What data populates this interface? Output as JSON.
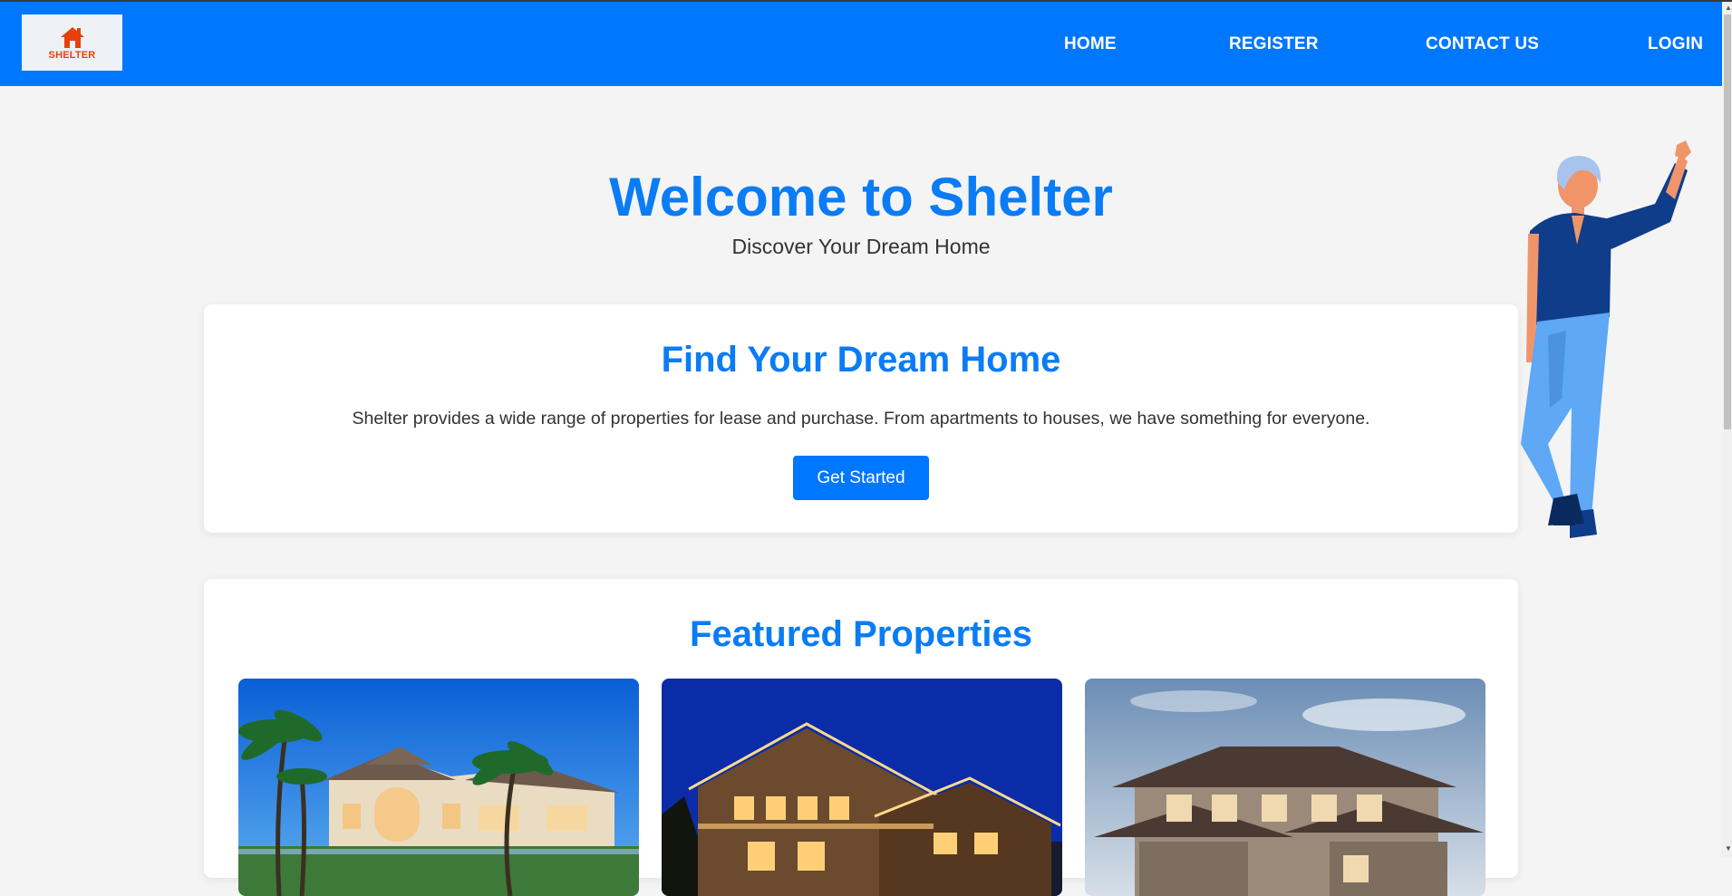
{
  "logo": {
    "text": "SHELTER",
    "icon": "house-icon",
    "color": "#e8400c"
  },
  "nav": {
    "items": [
      {
        "label": "HOME"
      },
      {
        "label": "REGISTER"
      },
      {
        "label": "CONTACT US"
      },
      {
        "label": "LOGIN"
      }
    ],
    "background": "#0077ff"
  },
  "hero": {
    "title": "Welcome to Shelter",
    "subtitle": "Discover Your Dream Home"
  },
  "find": {
    "title": "Find Your Dream Home",
    "text": "Shelter provides a wide range of properties for lease and purchase. From apartments to houses, we have something for everyone.",
    "button": "Get Started"
  },
  "featured": {
    "title": "Featured Properties",
    "properties": [
      {
        "image": "mediterranean-villa-with-palms"
      },
      {
        "image": "lit-mountain-lodge-at-night"
      },
      {
        "image": "modern-two-story-house-at-dusk"
      }
    ]
  },
  "colors": {
    "accent": "#0a7cf5",
    "brand": "#0077ff",
    "page": "#f4f4f4"
  }
}
